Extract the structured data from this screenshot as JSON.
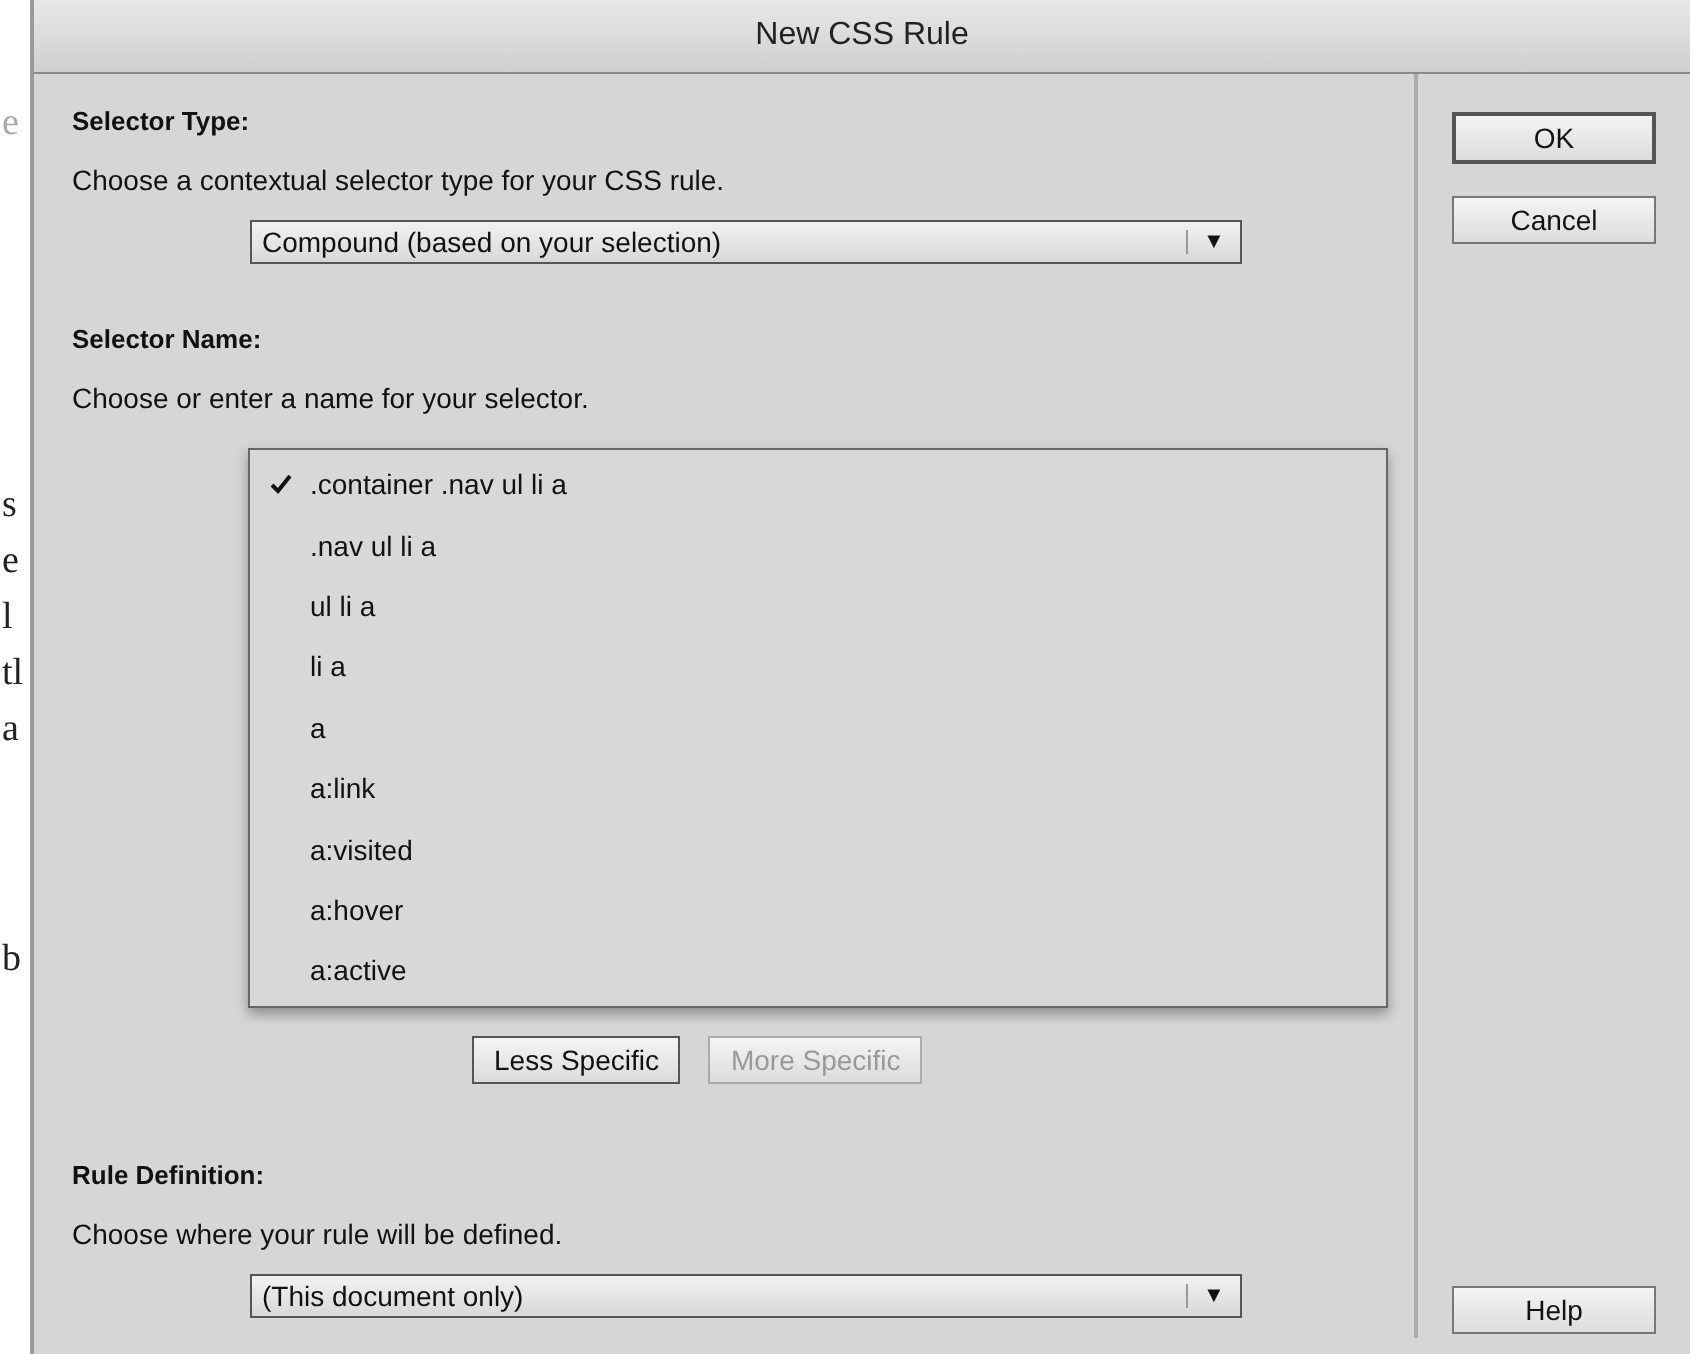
{
  "background_fragments": [
    "e",
    "s",
    "e",
    "l",
    "tl",
    "a",
    "b"
  ],
  "window": {
    "title": "New CSS Rule"
  },
  "selector_type": {
    "heading": "Selector Type:",
    "instruction": "Choose a contextual selector type for your CSS rule.",
    "dropdown": {
      "value": "Compound (based on your selection)",
      "arrow": "▼"
    }
  },
  "selector_name": {
    "heading": "Selector Name:",
    "instruction": "Choose or enter a name for your selector.",
    "list": [
      {
        "label": ".container .nav ul li a",
        "selected": true
      },
      {
        "label": ".nav ul li a",
        "selected": false
      },
      {
        "label": "ul li a",
        "selected": false
      },
      {
        "label": "li a",
        "selected": false
      },
      {
        "label": "a",
        "selected": false
      },
      {
        "label": "a:link",
        "selected": false
      },
      {
        "label": "a:visited",
        "selected": false
      },
      {
        "label": "a:hover",
        "selected": false
      },
      {
        "label": "a:active",
        "selected": false
      }
    ],
    "buttons": [
      {
        "label": "Less Specific",
        "disabled": false
      },
      {
        "label": "More Specific",
        "disabled": true
      }
    ]
  },
  "rule_definition": {
    "heading": "Rule Definition:",
    "instruction": "Choose where your rule will be defined.",
    "dropdown": {
      "value": "(This document only)",
      "arrow": "▼"
    }
  },
  "side_buttons": [
    {
      "label": "OK",
      "default": true
    },
    {
      "label": "Cancel",
      "default": false
    }
  ],
  "help_button": {
    "label": "Help"
  }
}
